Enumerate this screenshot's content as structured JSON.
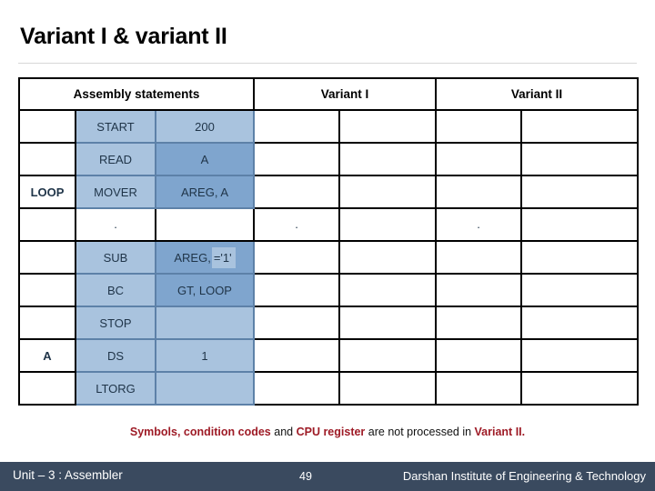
{
  "slide": {
    "title": "Variant I & variant II"
  },
  "table": {
    "headers": {
      "assembly": "Assembly statements",
      "variant_1": "Variant I",
      "variant_2": "Variant II"
    },
    "rows": [
      {
        "label": "",
        "mnemonic": "START",
        "operand": "200",
        "operand_style": "light",
        "v1a": "",
        "v1b": "",
        "v2a": "",
        "v2b": ""
      },
      {
        "label": "",
        "mnemonic": "READ",
        "operand": "A",
        "operand_style": "dark",
        "v1a": "",
        "v1b": "",
        "v2a": "",
        "v2b": ""
      },
      {
        "label": "LOOP",
        "mnemonic": "MOVER",
        "operand": "AREG, A",
        "operand_style": "dark",
        "v1a": "",
        "v1b": "",
        "v2a": "",
        "v2b": ""
      },
      {
        "label": "",
        "mnemonic": ".",
        "operand": "",
        "operand_style": "none",
        "v1a": ".",
        "v1b": "",
        "v2a": ".",
        "v2b": ""
      },
      {
        "label": "",
        "mnemonic": "SUB",
        "operand": "AREG, ='1'",
        "operand_style": "split",
        "operand_part_1": "AREG,",
        "operand_part_2": "='1'",
        "v1a": "",
        "v1b": "",
        "v2a": "",
        "v2b": ""
      },
      {
        "label": "",
        "mnemonic": "BC",
        "operand": "GT, LOOP",
        "operand_style": "dark",
        "v1a": "",
        "v1b": "",
        "v2a": "",
        "v2b": ""
      },
      {
        "label": "",
        "mnemonic": "STOP",
        "operand": "",
        "operand_style": "light",
        "v1a": "",
        "v1b": "",
        "v2a": "",
        "v2b": ""
      },
      {
        "label": "A",
        "mnemonic": "DS",
        "operand": "1",
        "operand_style": "light",
        "v1a": "",
        "v1b": "",
        "v2a": "",
        "v2b": ""
      },
      {
        "label": "",
        "mnemonic": "LTORG",
        "operand": "",
        "operand_style": "light",
        "v1a": "",
        "v1b": "",
        "v2a": "",
        "v2b": ""
      }
    ]
  },
  "note": {
    "part_1": "Symbols, condition codes",
    "part_2": " and ",
    "part_3": "CPU register",
    "part_4": " are not processed in ",
    "part_5": "Variant II."
  },
  "footer": {
    "unit": "Unit – 3 : Assembler",
    "page": "49",
    "organization": "Darshan Institute of Engineering & Technology"
  },
  "colors": {
    "cell_light": "#a9c3de",
    "cell_dark": "#7fa5ce",
    "note_highlight": "#9e1b26",
    "footer_bar": "#3a4a5f",
    "text_blue": "#1f3448"
  }
}
